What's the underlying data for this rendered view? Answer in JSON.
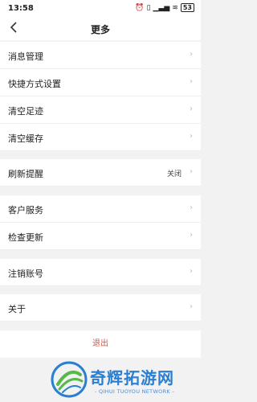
{
  "status_bar": {
    "time": "13:58",
    "icons": [
      "alarm-icon",
      "vibrate-icon",
      "signal-icon",
      "wifi-icon"
    ],
    "battery": "53"
  },
  "header": {
    "back_icon": "chevron-left-icon",
    "title": "更多"
  },
  "menu": {
    "message_management": "消息管理",
    "shortcut_settings": "快捷方式设置",
    "clear_footprints": "清空足迹",
    "clear_cache": "清空缓存",
    "refresh_reminder": "刷新提醒",
    "refresh_reminder_value": "关闭",
    "customer_service": "客户服务",
    "check_update": "检查更新",
    "cancel_account": "注销账号",
    "about": "关于"
  },
  "logout_label": "退出",
  "watermark": {
    "title": "奇辉拓游网",
    "subtitle": "- QIHUI TUOYOU NETWORK -"
  },
  "colors": {
    "logout_text": "#e84c3d",
    "watermark_blue": "#2b7fd0",
    "watermark_green": "#57b947"
  }
}
